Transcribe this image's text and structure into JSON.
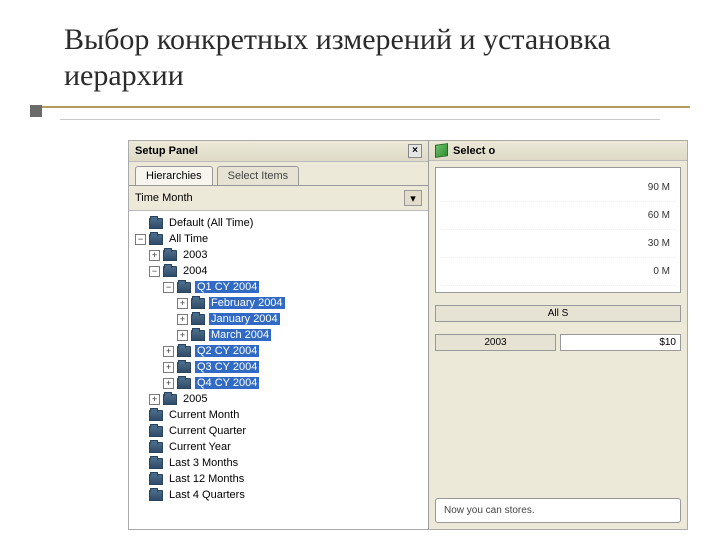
{
  "slide": {
    "title": "Выбор конкретных измерений и установка иерархии"
  },
  "panel": {
    "title": "Setup Panel",
    "close_glyph": "×",
    "tabs": {
      "hierarchies": "Hierarchies",
      "select_items": "Select Items"
    },
    "dimension_label": "Time Month",
    "action_glyph": "▾"
  },
  "tree": {
    "default": "Default (All Time)",
    "all_time": "All Time",
    "y2003": "2003",
    "y2004": "2004",
    "q1": "Q1 CY 2004",
    "feb": "February 2004",
    "jan": "January 2004",
    "mar": "March 2004",
    "q2": "Q2 CY 2004",
    "q3": "Q3 CY 2004",
    "q4": "Q4 CY 2004",
    "y2005": "2005",
    "cm": "Current Month",
    "cq": "Current Quarter",
    "cy": "Current Year",
    "l3": "Last 3 Months",
    "l12": "Last 12 Months",
    "l4q": "Last 4 Quarters"
  },
  "right": {
    "header": "Select o",
    "yticks": [
      "90 M",
      "60 M",
      "30 M",
      "0 M"
    ],
    "grid_header": "All S",
    "grid_year": "2003",
    "grid_val": "$10",
    "message": "Now you can\nstores."
  }
}
